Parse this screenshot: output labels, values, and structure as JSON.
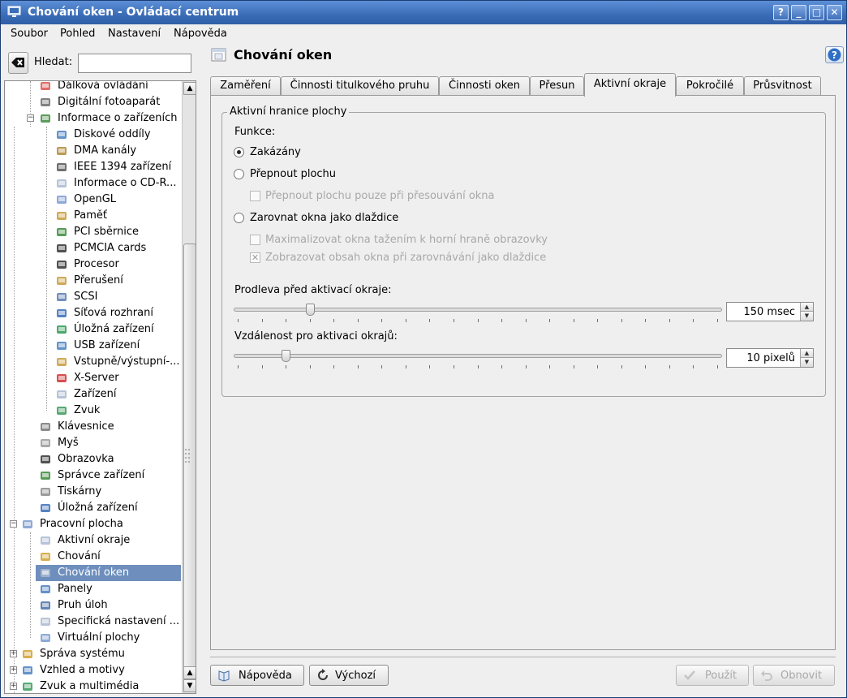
{
  "window": {
    "title": "Chování oken - Ovládací centrum",
    "buttons": {
      "help": "?",
      "minimize": "_",
      "maximize": "□",
      "close": "✕"
    }
  },
  "menubar": [
    "Soubor",
    "Pohled",
    "Nastavení",
    "Nápověda"
  ],
  "search": {
    "label": "Hledat:",
    "value": ""
  },
  "tree": [
    {
      "label": "Dálková ovládání",
      "icon": "remote-icon"
    },
    {
      "label": "Digitální fotoaparát",
      "icon": "camera-icon"
    },
    {
      "label": "Informace o zařízeních",
      "icon": "device-info-icon"
    },
    {
      "label": "Diskové oddíly",
      "icon": "partition-icon"
    },
    {
      "label": "DMA kanály",
      "icon": "dma-icon"
    },
    {
      "label": "IEEE 1394 zařízení",
      "icon": "firewire-icon"
    },
    {
      "label": "Informace o CD-R...",
      "icon": "cdrom-icon"
    },
    {
      "label": "OpenGL",
      "icon": "opengl-icon"
    },
    {
      "label": "Paměť",
      "icon": "memory-icon"
    },
    {
      "label": "PCI sběrnice",
      "icon": "pci-icon"
    },
    {
      "label": "PCMCIA cards",
      "icon": "pcmcia-icon"
    },
    {
      "label": "Procesor",
      "icon": "cpu-icon"
    },
    {
      "label": "Přerušení",
      "icon": "interrupt-icon"
    },
    {
      "label": "SCSI",
      "icon": "scsi-icon"
    },
    {
      "label": "Síťová rozhraní",
      "icon": "network-icon"
    },
    {
      "label": "Úložná zařízení",
      "icon": "storage-icon"
    },
    {
      "label": "USB zařízení",
      "icon": "usb-icon"
    },
    {
      "label": "Vstupně/výstupní-...",
      "icon": "io-icon"
    },
    {
      "label": "X-Server",
      "icon": "x-server-icon"
    },
    {
      "label": "Zařízení",
      "icon": "device-icon"
    },
    {
      "label": "Zvuk",
      "icon": "sound-icon"
    },
    {
      "label": "Klávesnice",
      "icon": "keyboard-icon"
    },
    {
      "label": "Myš",
      "icon": "mouse-icon"
    },
    {
      "label": "Obrazovka",
      "icon": "display-icon"
    },
    {
      "label": "Správce zařízení",
      "icon": "device-manager-icon"
    },
    {
      "label": "Tiskárny",
      "icon": "printer-icon"
    },
    {
      "label": "Úložná zařízení",
      "icon": "storage-icon"
    },
    {
      "label": "Pracovní plocha",
      "icon": "desktop-icon"
    },
    {
      "label": "Aktivní okraje",
      "icon": "window-icon"
    },
    {
      "label": "Chování",
      "icon": "behavior-icon"
    },
    {
      "label": "Chování oken",
      "icon": "window-behavior-icon"
    },
    {
      "label": "Panely",
      "icon": "panel-icon"
    },
    {
      "label": "Pruh úloh",
      "icon": "taskbar-icon"
    },
    {
      "label": "Specifická nastavení ...",
      "icon": "window-specific-icon"
    },
    {
      "label": "Virtuální plochy",
      "icon": "virtual-desktop-icon"
    },
    {
      "label": "Správa systému",
      "icon": "system-admin-icon"
    },
    {
      "label": "Vzhled a motivy",
      "icon": "appearance-icon"
    },
    {
      "label": "Zvuk a multimédia",
      "icon": "multimedia-icon"
    }
  ],
  "page": {
    "title": "Chování oken"
  },
  "tabs": [
    "Zaměření",
    "Činnosti titulkového pruhu",
    "Činnosti oken",
    "Přesun",
    "Aktivní okraje",
    "Pokročilé",
    "Průsvitnost"
  ],
  "active_tab": "Aktivní okraje",
  "edges": {
    "group_title": "Aktivní hranice plochy",
    "function_label": "Funkce:",
    "options": {
      "disabled": "Zakázány",
      "switch_desktop": "Přepnout plochu",
      "switch_only_when_moving": "Přepnout plochu pouze při přesouvání okna",
      "tile": "Zarovnat okna jako dlaždice",
      "maximize_drag": "Maximalizovat okna tažením k horní hraně obrazovky",
      "show_content": "Zobrazovat obsah okna při zarovnávání jako dlaždice"
    },
    "selected_option": "Zakázány",
    "show_content_checked": true,
    "delay_label": "Prodleva před aktivací okraje:",
    "delay_value": "150 msec",
    "delay_fraction": 0.15,
    "distance_label": "Vzdálenost pro aktivaci okrajů:",
    "distance_value": "10 pixelů",
    "distance_fraction": 0.1
  },
  "buttons": {
    "help": "Nápověda",
    "defaults": "Výchozí",
    "apply": "Použít",
    "reset": "Obnovit"
  }
}
